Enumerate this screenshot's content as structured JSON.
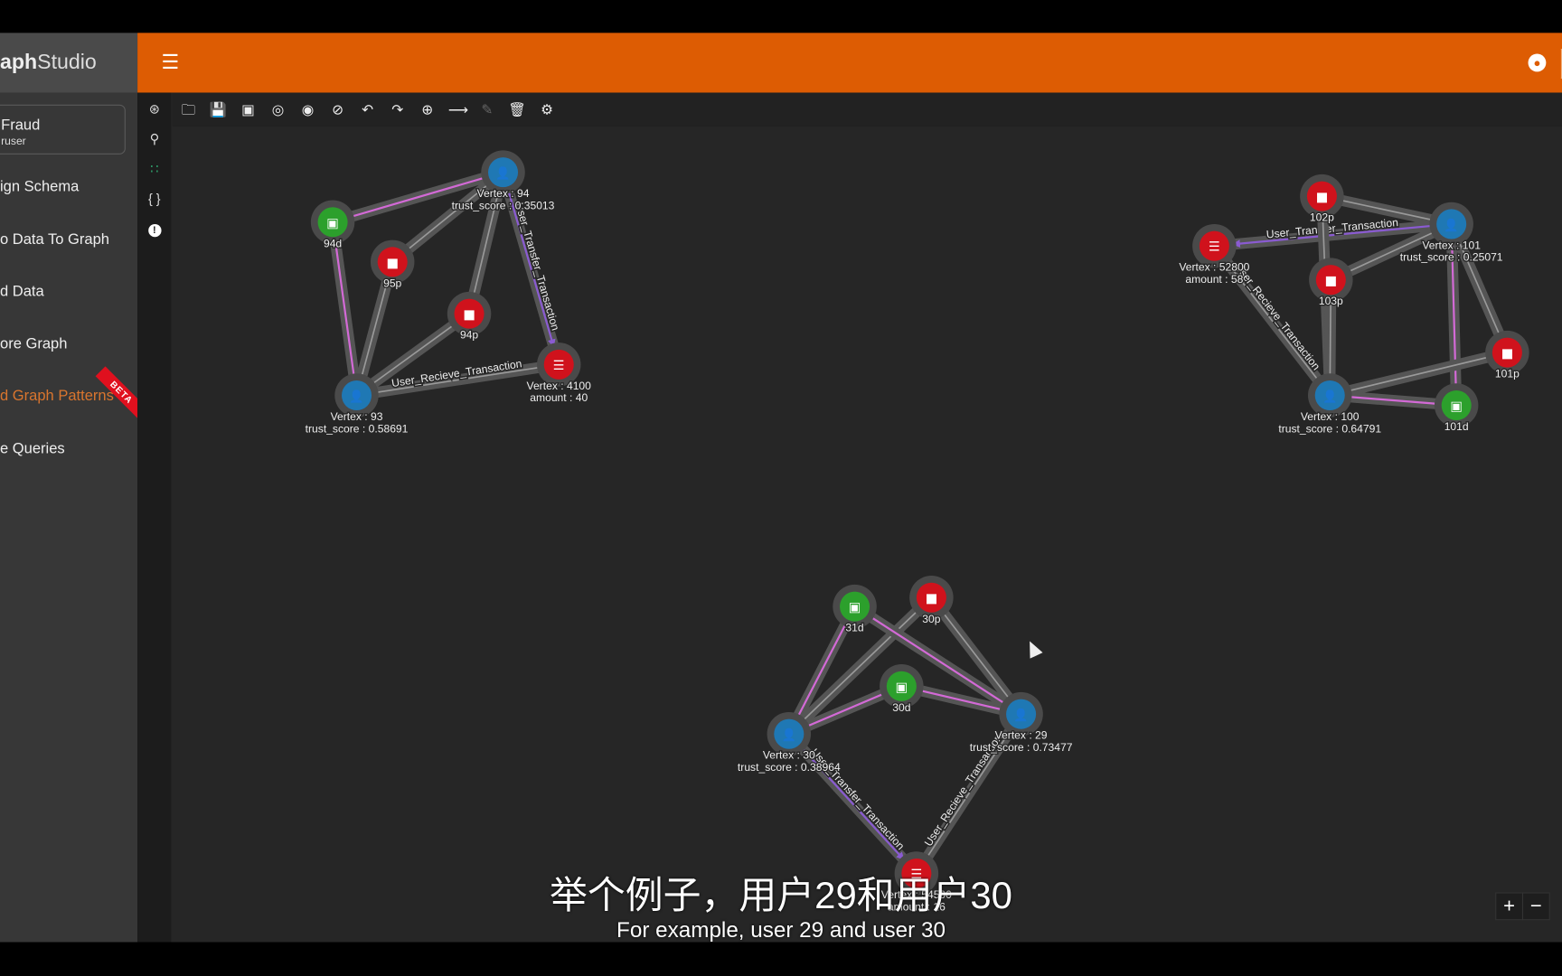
{
  "header": {
    "brand_bold": "aph",
    "brand_light": "Studio",
    "menu_icon": "hamburger-icon",
    "user_icon": "account-circle-icon",
    "accent": "#dd5c03"
  },
  "sidebar": {
    "project_name": "Fraud",
    "project_user": "ruser",
    "items": [
      {
        "label": "ign Schema"
      },
      {
        "label": "o Data To Graph"
      },
      {
        "label": "d Data"
      },
      {
        "label": "ore Graph"
      },
      {
        "label": "d Graph Patterns",
        "active": true
      },
      {
        "label": "e Queries"
      }
    ],
    "beta_label": "BETA"
  },
  "icon_column": [
    "collapse-icon",
    "schema-icon",
    "graph-pattern-icon",
    "json-icon",
    "alert-icon"
  ],
  "toolbar": [
    "open-folder-icon",
    "save-icon",
    "screenshot-icon",
    "locate-icon",
    "show-icon",
    "hide-icon",
    "undo-icon",
    "redo-icon",
    "add-vertex-icon",
    "add-edge-icon",
    "edit-icon",
    "delete-icon",
    "settings-icon"
  ],
  "graph": {
    "colors": {
      "user": "#1f78b4",
      "device": "#2ca02c",
      "phone": "#d0121c",
      "transaction": "#d0121c",
      "halo": "#4a4a4a",
      "pink_edge": "#d36ad6",
      "arrow": "#8a5bd1"
    },
    "nodes": [
      {
        "id": "94",
        "type": "user",
        "lines": [
          "Vertex : 94",
          "trust_score : 0.35013"
        ]
      },
      {
        "id": "94d",
        "type": "device",
        "lines": [
          "94d"
        ]
      },
      {
        "id": "95p",
        "type": "phone",
        "lines": [
          "95p"
        ]
      },
      {
        "id": "94p",
        "type": "phone",
        "lines": [
          "94p"
        ]
      },
      {
        "id": "93",
        "type": "user",
        "lines": [
          "Vertex : 93",
          "trust_score : 0.58691"
        ]
      },
      {
        "id": "4100",
        "type": "transaction",
        "lines": [
          "Vertex : 4100",
          "amount : 40"
        ]
      },
      {
        "id": "102p",
        "type": "phone",
        "lines": [
          "102p"
        ]
      },
      {
        "id": "101",
        "type": "user",
        "lines": [
          "Vertex : 101",
          "trust_score : 0.25071"
        ]
      },
      {
        "id": "52800",
        "type": "transaction",
        "lines": [
          "Vertex : 52800",
          "amount : 58"
        ]
      },
      {
        "id": "103p",
        "type": "phone",
        "lines": [
          "103p"
        ]
      },
      {
        "id": "101p",
        "type": "phone",
        "lines": [
          "101p"
        ]
      },
      {
        "id": "100",
        "type": "user",
        "lines": [
          "Vertex : 100",
          "trust_score : 0.64791"
        ]
      },
      {
        "id": "101d",
        "type": "device",
        "lines": [
          "101d"
        ]
      },
      {
        "id": "31d",
        "type": "device",
        "lines": [
          "31d"
        ]
      },
      {
        "id": "30p",
        "type": "phone",
        "lines": [
          "30p"
        ]
      },
      {
        "id": "30d",
        "type": "device",
        "lines": [
          "30d"
        ]
      },
      {
        "id": "30",
        "type": "user",
        "lines": [
          "Vertex : 30",
          "trust_score : 0.38964"
        ]
      },
      {
        "id": "29",
        "type": "user",
        "lines": [
          "Vertex : 29",
          "trust_score : 0.73477"
        ]
      },
      {
        "id": "54500",
        "type": "transaction",
        "lines": [
          "Vertex : 54500",
          "amount : 16"
        ]
      }
    ],
    "edges": [
      {
        "from": "94",
        "to": "94d",
        "style": "pink"
      },
      {
        "from": "94",
        "to": "95p"
      },
      {
        "from": "94",
        "to": "94p"
      },
      {
        "from": "94d",
        "to": "93",
        "style": "pink"
      },
      {
        "from": "95p",
        "to": "93"
      },
      {
        "from": "94p",
        "to": "93"
      },
      {
        "from": "93",
        "to": "4100",
        "label": "User_Recieve_Transaction"
      },
      {
        "from": "94",
        "to": "4100",
        "label": "User_Transfer_Transaction",
        "arrow": true
      },
      {
        "from": "102p",
        "to": "101"
      },
      {
        "from": "101",
        "to": "52800",
        "label": "User_Transfer_Transaction",
        "arrow": true
      },
      {
        "from": "102p",
        "to": "100"
      },
      {
        "from": "103p",
        "to": "101"
      },
      {
        "from": "103p",
        "to": "100"
      },
      {
        "from": "101",
        "to": "101p"
      },
      {
        "from": "101",
        "to": "101d",
        "style": "pink"
      },
      {
        "from": "100",
        "to": "101p"
      },
      {
        "from": "100",
        "to": "101d",
        "style": "pink"
      },
      {
        "from": "52800",
        "to": "100",
        "label": "User_Recieve_Transaction"
      },
      {
        "from": "30",
        "to": "31d",
        "style": "pink"
      },
      {
        "from": "30",
        "to": "30p"
      },
      {
        "from": "30",
        "to": "30d",
        "style": "pink"
      },
      {
        "from": "29",
        "to": "31d",
        "style": "pink"
      },
      {
        "from": "29",
        "to": "30p"
      },
      {
        "from": "29",
        "to": "30d",
        "style": "pink"
      },
      {
        "from": "30",
        "to": "54500",
        "label": "User_Transfer_Transaction",
        "arrow": true
      },
      {
        "from": "29",
        "to": "54500",
        "label": "User_Recieve_Transaction"
      }
    ]
  },
  "zoom_controls": {
    "zoom_in": "+",
    "zoom_out": "−"
  },
  "subtitles": {
    "zh": "举个例子，用户29和用户30",
    "en": "For example, user 29 and user 30"
  }
}
